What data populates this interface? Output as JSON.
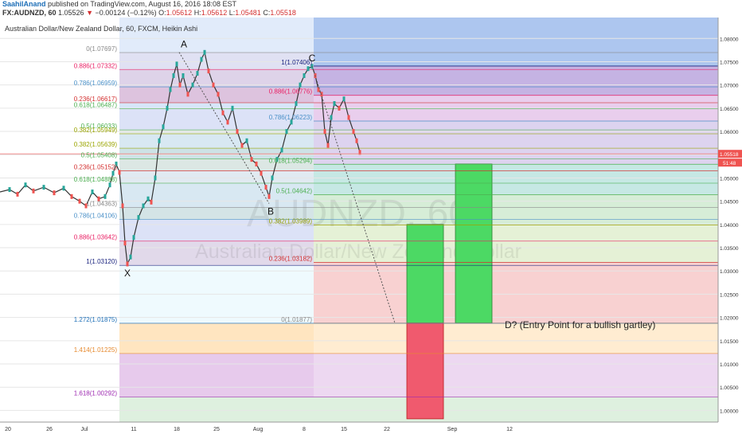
{
  "header": {
    "user": "SaahilAnand",
    "published_text": " published on TradingView.com, August 16, 2016 18:08 EST",
    "symbol": "FX:AUDNZD, 60",
    "price": "1.05526",
    "change_arrow": "▼",
    "change": "−0.00124 (−0.12%)",
    "o_label": "O:",
    "o_value": "1.05612",
    "h_label": "H:",
    "h_value": "1.05612",
    "l_label": "L:",
    "l_value": "1.05481",
    "c_label": "C:",
    "c_value": "1.05518"
  },
  "chart_data": {
    "type": "candlestick",
    "title": "Australian Dollar/New Zealand Dollar, 60, FXCM, Heikin Ashi",
    "watermark_symbol": "AUDNZD, 60",
    "watermark_name": "Australian Dollar/New Zealand Dollar",
    "ylim": [
      0.9975,
      1.0845
    ],
    "y_ticks": [
      "1.08000",
      "1.07500",
      "1.07000",
      "1.06500",
      "1.06000",
      "1.05500",
      "1.05000",
      "1.04500",
      "1.04000",
      "1.03500",
      "1.03000",
      "1.02500",
      "1.02000",
      "1.01500",
      "1.01000",
      "1.00500",
      "1.00000"
    ],
    "x_ticks": [
      "20",
      "26",
      "Jul",
      "11",
      "18",
      "25",
      "Aug",
      "8",
      "15",
      "22",
      "Sep",
      "12"
    ],
    "last_price": "1.05518",
    "countdown": "51:48",
    "price_path": [
      [
        0,
        1.047
      ],
      [
        12,
        1.0475
      ],
      [
        22,
        1.0465
      ],
      [
        32,
        1.0485
      ],
      [
        42,
        1.0472
      ],
      [
        55,
        1.048
      ],
      [
        68,
        1.0468
      ],
      [
        80,
        1.0478
      ],
      [
        90,
        1.046
      ],
      [
        100,
        1.045
      ],
      [
        108,
        1.044
      ],
      [
        116,
        1.047
      ],
      [
        124,
        1.0455
      ],
      [
        132,
        1.046
      ],
      [
        138,
        1.0485
      ],
      [
        142,
        1.051
      ],
      [
        146,
        1.053
      ],
      [
        150,
        1.0512
      ],
      [
        154,
        1.044
      ],
      [
        157,
        1.036
      ],
      [
        160,
        1.0315
      ],
      [
        164,
        1.033
      ],
      [
        168,
        1.0372
      ],
      [
        174,
        1.0415
      ],
      [
        180,
        1.044
      ],
      [
        186,
        1.0455
      ],
      [
        190,
        1.0448
      ],
      [
        195,
        1.05
      ],
      [
        200,
        1.058
      ],
      [
        205,
        1.061
      ],
      [
        210,
        1.065
      ],
      [
        214,
        1.069
      ],
      [
        218,
        1.072
      ],
      [
        222,
        1.0745
      ],
      [
        226,
        1.07
      ],
      [
        230,
        1.072
      ],
      [
        236,
        1.068
      ],
      [
        242,
        1.07
      ],
      [
        248,
        1.0725
      ],
      [
        253,
        1.0755
      ],
      [
        257,
        1.077
      ],
      [
        262,
        1.073
      ],
      [
        268,
        1.07
      ],
      [
        274,
        1.068
      ],
      [
        280,
        1.064
      ],
      [
        286,
        1.062
      ],
      [
        292,
        1.065
      ],
      [
        298,
        1.06
      ],
      [
        304,
        1.057
      ],
      [
        310,
        1.058
      ],
      [
        316,
        1.054
      ],
      [
        322,
        1.053
      ],
      [
        328,
        1.051
      ],
      [
        334,
        1.048
      ],
      [
        338,
        1.046
      ],
      [
        342,
        1.05
      ],
      [
        348,
        1.054
      ],
      [
        354,
        1.056
      ],
      [
        360,
        1.06
      ],
      [
        366,
        1.062
      ],
      [
        372,
        1.066
      ],
      [
        377,
        1.07
      ],
      [
        382,
        1.072
      ],
      [
        387,
        1.0735
      ],
      [
        392,
        1.074
      ],
      [
        396,
        1.072
      ],
      [
        400,
        1.069
      ],
      [
        404,
        1.068
      ],
      [
        408,
        1.06
      ],
      [
        412,
        1.057
      ],
      [
        416,
        1.063
      ],
      [
        420,
        1.066
      ],
      [
        426,
        1.065
      ],
      [
        432,
        1.067
      ],
      [
        438,
        1.063
      ],
      [
        444,
        1.06
      ],
      [
        448,
        1.058
      ],
      [
        452,
        1.0555
      ]
    ]
  },
  "fib_levels": [
    {
      "label": "0(1.07697)",
      "value": 1.07697,
      "color": "#888888"
    },
    {
      "label": "0.886(1.07332)",
      "value": 1.07332,
      "color": "#e91e63"
    },
    {
      "label": "0.786(1.06959)",
      "value": 1.06959,
      "color": "#4a90c8"
    },
    {
      "label": "0.236(1.06617)",
      "value": 1.06617,
      "color": "#d32f2f"
    },
    {
      "label": "0.618(1.06487)",
      "value": 1.06487,
      "color": "#4caf50"
    },
    {
      "label": "0.5(1.06033)",
      "value": 1.06033,
      "color": "#4caf50"
    },
    {
      "label": "0.382(1.05949)",
      "value": 1.05949,
      "color": "#9aa500"
    },
    {
      "label": "0.382(1.05639)",
      "value": 1.05639,
      "color": "#9aa500"
    },
    {
      "label": "0.5(1.05408)",
      "value": 1.05408,
      "color": "#4caf50"
    },
    {
      "label": "0.236(1.05152)",
      "value": 1.05152,
      "color": "#d32f2f"
    },
    {
      "label": "0.618(1.04888)",
      "value": 1.04888,
      "color": "#4caf50"
    },
    {
      "label": "1(1.04363)",
      "value": 1.04363,
      "color": "#888888"
    },
    {
      "label": "0.786(1.04106)",
      "value": 1.04106,
      "color": "#4a90c8"
    },
    {
      "label": "0.886(1.03642)",
      "value": 1.03642,
      "color": "#e91e63"
    },
    {
      "label": "1(1.03120)",
      "value": 1.0312,
      "color": "#1a237e"
    },
    {
      "label": "1.272(1.01875)",
      "value": 1.01875,
      "color": "#1e6fb7"
    },
    {
      "label": "1.414(1.01225)",
      "value": 1.01225,
      "color": "#e6892e"
    },
    {
      "label": "1.618(1.00292)",
      "value": 1.00292,
      "color": "#9c27b0"
    }
  ],
  "fib_levels_bc": [
    {
      "label": "1(1.07406)",
      "value": 1.07406,
      "color": "#1a237e"
    },
    {
      "label": "0.886(1.06776)",
      "value": 1.06776,
      "color": "#e91e63"
    },
    {
      "label": "0.786(1.06223)",
      "value": 1.06223,
      "color": "#4a90c8"
    },
    {
      "label": "0.618(1.05294)",
      "value": 1.05294,
      "color": "#4caf50"
    },
    {
      "label": "0.5(1.04642)",
      "value": 1.04642,
      "color": "#4caf50"
    },
    {
      "label": "0.382(1.03989)",
      "value": 1.03989,
      "color": "#9aa500"
    },
    {
      "label": "0.236(1.03182)",
      "value": 1.03182,
      "color": "#d32f2f"
    },
    {
      "label": "0(1.01877)",
      "value": 1.01877,
      "color": "#888888"
    }
  ],
  "points": [
    {
      "label": "X",
      "value": 1.0312
    },
    {
      "label": "A",
      "value": 1.07703
    },
    {
      "label": "B",
      "value": 1.0445
    },
    {
      "label": "C",
      "value": 1.07406
    }
  ],
  "annotation": "D? (Entry Point for a bullish gartley)",
  "colors": {
    "up_box": "#4cd964",
    "down_box": "#f05a6e",
    "price_line": "#f08080"
  }
}
